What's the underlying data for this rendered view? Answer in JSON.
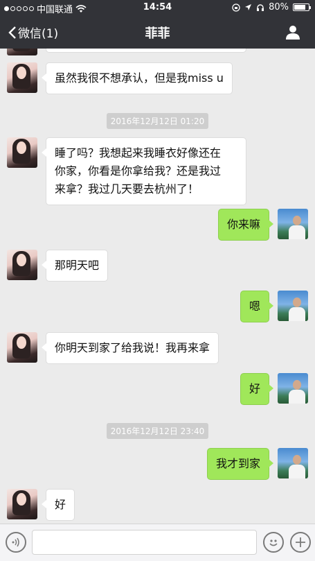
{
  "status_bar": {
    "carrier": "中国联通",
    "time": "14:54",
    "battery": "80%",
    "battery_level": 0.8
  },
  "nav": {
    "back_label": "微信(1)",
    "title": "菲菲"
  },
  "messages": [
    {
      "from": "her",
      "text": "虽然我很不想承认，但是我miss u"
    },
    {
      "type": "time",
      "text": "2016年12月12日 01:20"
    },
    {
      "from": "her",
      "lines": [
        "睡了吗？我想起来我睡衣好像还在",
        "你家，你看是你拿给我？还是我过",
        "来拿？我过几天要去杭州了！"
      ]
    },
    {
      "from": "me",
      "text": "你来嘛"
    },
    {
      "from": "her",
      "text": "那明天吧"
    },
    {
      "from": "me",
      "text": "嗯"
    },
    {
      "from": "her",
      "text": "你明天到家了给我说！我再来拿"
    },
    {
      "from": "me",
      "text": "好"
    },
    {
      "type": "time",
      "text": "2016年12月12日 23:40"
    },
    {
      "from": "me",
      "text": "我才到家"
    },
    {
      "from": "her",
      "text": "好"
    }
  ],
  "input_bar": {
    "voice_icon": "voice-icon",
    "emoji_icon": "emoji-icon",
    "plus_icon": "plus-icon"
  }
}
